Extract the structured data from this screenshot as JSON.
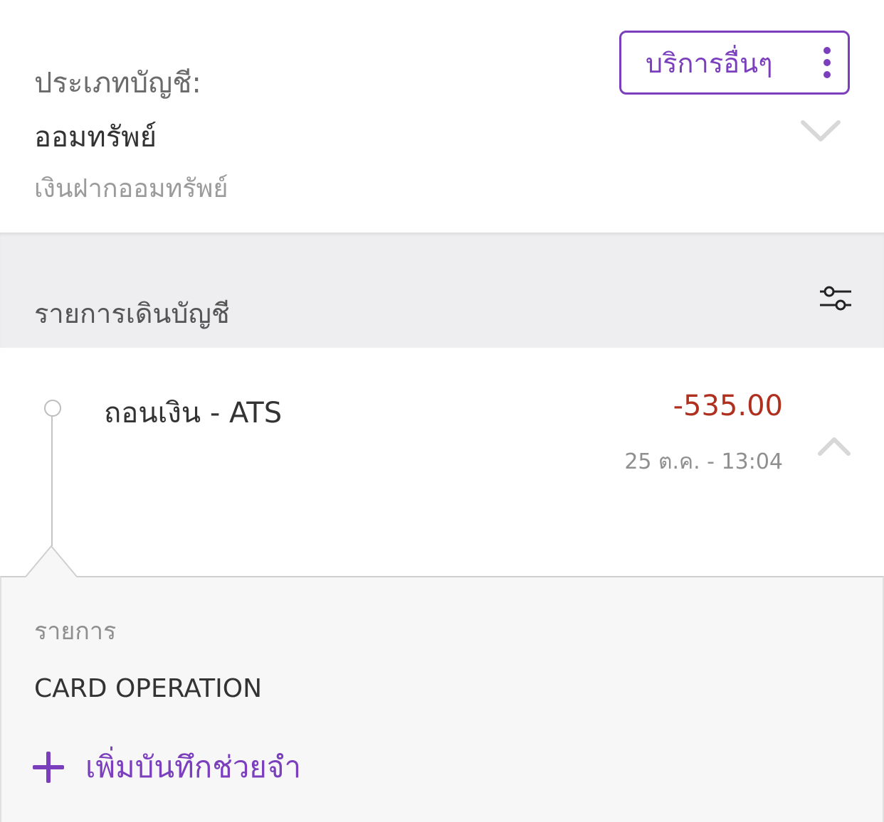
{
  "account": {
    "type_label": "ประเภทบัญชี:",
    "type_value": "ออมทรัพย์",
    "subtitle": "เงินฝากออมทรัพย์"
  },
  "more_services": {
    "label": "บริการอื่นๆ",
    "icon": "kebab-vertical-icon"
  },
  "statement": {
    "title": "รายการเดินบัญชี",
    "filter_icon": "filter-sliders-icon"
  },
  "transaction": {
    "title": "ถอนเงิน - ATS",
    "amount": "-535.00",
    "date": "25 ต.ค. - 13:04"
  },
  "detail": {
    "label": "รายการ",
    "value": "CARD OPERATION",
    "add_note_label": "เพิ่มบันทึกช่วยจำ"
  },
  "colors": {
    "accent": "#7b3fbe",
    "debit": "#b0301f",
    "section_bg": "#eeeef0",
    "detail_bg": "#f7f7f7"
  }
}
